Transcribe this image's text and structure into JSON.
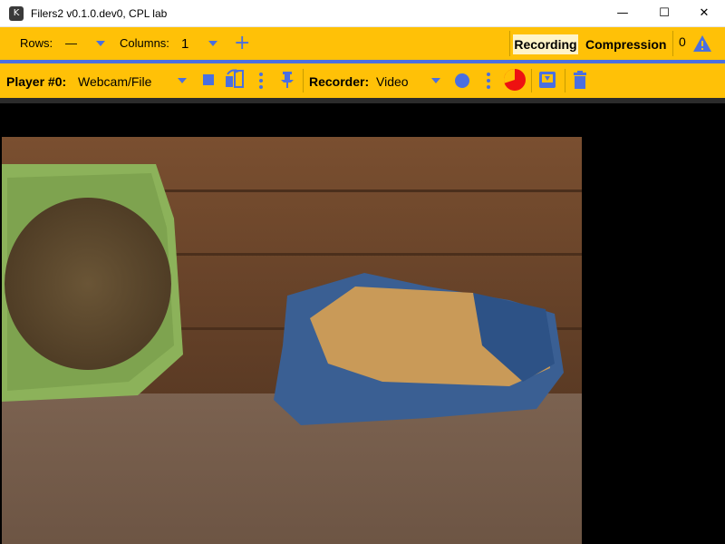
{
  "window": {
    "title": "Filers2 v0.1.0.dev0, CPL lab",
    "app_icon_glyph": "K"
  },
  "window_controls": {
    "minimize": "—",
    "maximize": "☐",
    "close": "✕"
  },
  "toolbar_top": {
    "rows_label": "Rows:",
    "rows_value": "—",
    "columns_label": "Columns:",
    "columns_value": "1",
    "add_glyph": "+",
    "tabs": {
      "recording": "Recording",
      "compression": "Compression"
    },
    "warning_count": "0",
    "warning_glyph": "!"
  },
  "toolbar_player": {
    "player_label": "Player #0:",
    "player_source": "Webcam/File",
    "recorder_label": "Recorder:",
    "recorder_type": "Video"
  },
  "colors": {
    "toolbar_bg": "#ffc107",
    "accent": "#4a6fe0",
    "record_red": "#ee1111"
  },
  "icons": [
    "player-dropdown-icon",
    "stop-icon",
    "flip-orientation-icon",
    "player-menu-icon",
    "pin-icon",
    "recorder-dropdown-icon",
    "record-icon",
    "recorder-menu-icon",
    "disk-usage-pie-icon",
    "save-download-icon",
    "delete-trash-icon",
    "warning-triangle-icon"
  ],
  "disk_usage_fraction": 0.7
}
